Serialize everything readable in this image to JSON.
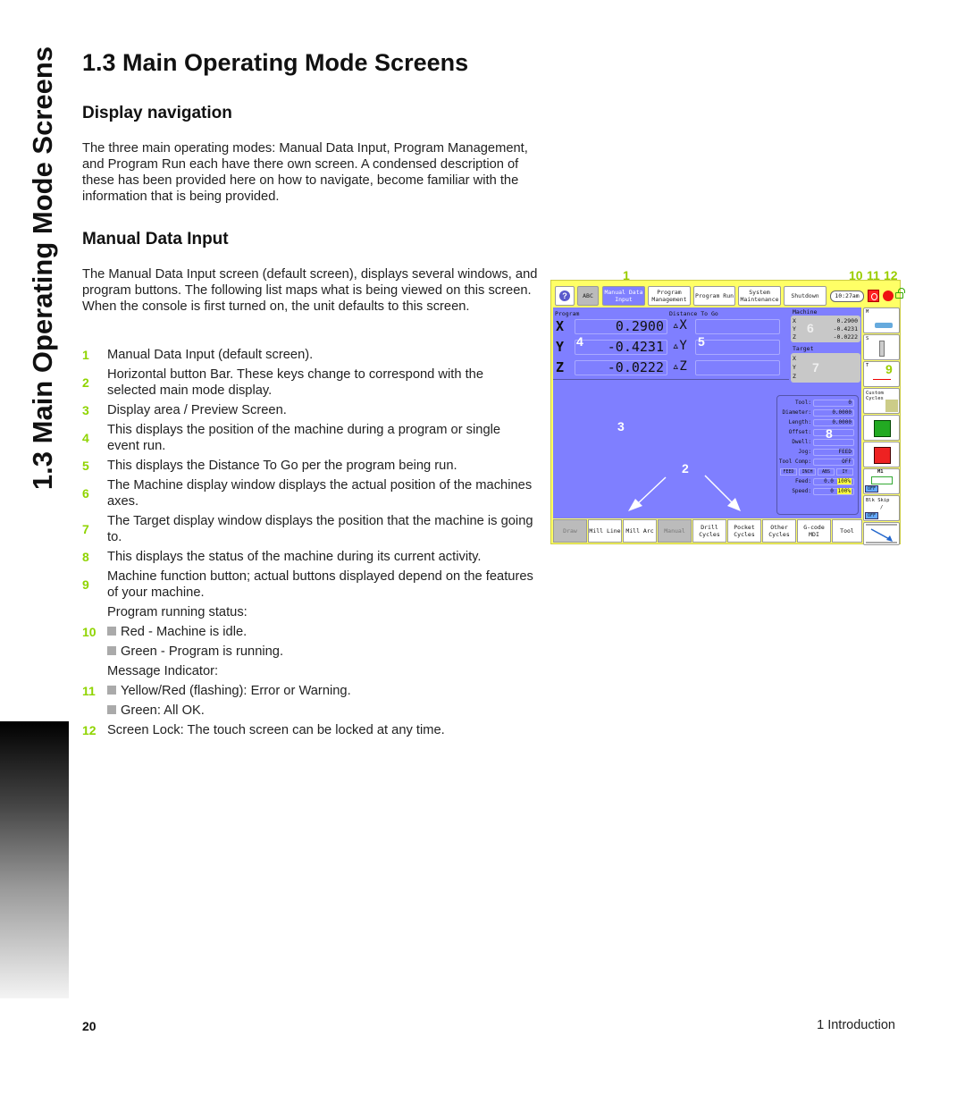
{
  "side_title": "1.3 Main Operating Mode Screens",
  "title": "1.3 Main Operating Mode Screens",
  "sections": {
    "display_navigation": {
      "heading": "Display navigation",
      "body": "The three main operating modes: Manual Data Input, Program Management, and Program Run each have there own screen.  A condensed description of these has been provided here on how to navigate, become familiar with the information that is being provided."
    },
    "manual_data_input": {
      "heading": "Manual Data Input",
      "body": "The Manual Data Input screen (default screen), displays several windows, and program buttons. The following list maps what is being viewed on this screen.  When the console is first turned on, the unit defaults to this screen."
    }
  },
  "list": [
    {
      "num": "1",
      "text": "Manual Data Input (default screen)."
    },
    {
      "num": "2",
      "text": "Horizontal button Bar.  These keys change to correspond with the selected main mode display."
    },
    {
      "num": "3",
      "text": "Display area / Preview Screen."
    },
    {
      "num": "4",
      "text": "This displays the position of the machine during a program or single event run."
    },
    {
      "num": "5",
      "text": "This displays the Distance To Go per the program being run."
    },
    {
      "num": "6",
      "text": "The Machine display window displays the actual position of the machines axes."
    },
    {
      "num": "7",
      "text": "The Target display window displays the position that the machine is going to."
    },
    {
      "num": "8",
      "text": "This displays the status of the machine during its current activity."
    },
    {
      "num": "9",
      "text": "Machine function button; actual buttons displayed depend on the features of your machine."
    },
    {
      "num": "",
      "text": "Program running status:"
    },
    {
      "num": "10",
      "text": "Red - Machine is idle.",
      "bullet": true
    },
    {
      "num": "",
      "text": "Green - Program is running.",
      "bullet": true
    },
    {
      "num": "",
      "text": "Message Indicator:"
    },
    {
      "num": "11",
      "text": "Yellow/Red (flashing): Error or Warning.",
      "bullet": true
    },
    {
      "num": "",
      "text": "Green: All OK.",
      "bullet": true
    },
    {
      "num": "12",
      "text": "Screen Lock:  The touch screen can be locked at any time."
    }
  ],
  "footer": {
    "page": "20",
    "chapter": "1 Introduction"
  },
  "screenshot": {
    "callouts": {
      "c1": "1",
      "c10": "10",
      "c11": "11",
      "c12": "12",
      "c2": "2",
      "c3": "3",
      "c4": "4",
      "c5": "5",
      "c6": "6",
      "c7": "7",
      "c8": "8",
      "c9": "9"
    },
    "top_buttons": {
      "help": "?",
      "abc": "ABC",
      "mdi": "Manual Data Input",
      "program_management": "Program Management",
      "program_run": "Program Run",
      "system_maintenance": "System Maintenance",
      "shutdown": "Shutdown"
    },
    "time": "10:27am",
    "program_label": "Program",
    "dtg_label": "Distance To Go",
    "axes": [
      {
        "axis": "X",
        "value": "0.2900",
        "dtg": "▵X"
      },
      {
        "axis": "Y",
        "value": "-0.4231",
        "dtg": "▵Y"
      },
      {
        "axis": "Z",
        "value": "-0.0222",
        "dtg": "▵Z"
      }
    ],
    "machine": {
      "label": "Machine",
      "rows": [
        {
          "axis": "X",
          "value": "0.2900"
        },
        {
          "axis": "Y",
          "value": "-0.4231"
        },
        {
          "axis": "Z",
          "value": "-0.0222"
        }
      ]
    },
    "target": {
      "label": "Target",
      "axes": [
        "X",
        "Y",
        "Z"
      ]
    },
    "status": {
      "tool": {
        "label": "Tool:",
        "value": "0"
      },
      "diameter": {
        "label": "Diameter:",
        "value": "0.0000"
      },
      "length": {
        "label": "Length:",
        "value": "0.0000"
      },
      "offset": {
        "label": "Offset:",
        "value": ""
      },
      "dwell": {
        "label": "Dwell:",
        "value": ""
      },
      "jog": {
        "label": "Jog:",
        "value": "FEED"
      },
      "tool_comp": {
        "label": "Tool Comp:",
        "value": "OFF"
      },
      "chips": [
        "FEED",
        "INCH",
        "ABS",
        "IY"
      ],
      "feed": {
        "label": "Feed:",
        "value": "0.0",
        "pct": "100%"
      },
      "speed": {
        "label": "Speed:",
        "value": "0",
        "pct": "100%"
      }
    },
    "side_buttons": {
      "m": "M",
      "s": "S",
      "t": "T",
      "custom_cycles": "Custom Cycles",
      "m1": "M1",
      "m1_state": "OFF",
      "blk_skip": "Blk Skip",
      "blk_skip_symbol": "/",
      "blk_skip_state": "OFF"
    },
    "bottom_buttons": [
      "Draw",
      "Mill Line",
      "Mill Arc",
      "Manual",
      "Drill Cycles",
      "Pocket Cycles",
      "Other Cycles",
      "G-code MDI",
      "Tool"
    ],
    "colors": {
      "background": "#7f7fff",
      "frame": "#ffff66",
      "callout": "#9acd00",
      "status_red": "#ff2020"
    }
  }
}
